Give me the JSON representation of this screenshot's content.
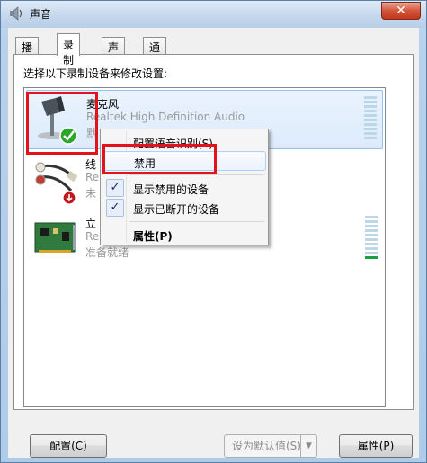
{
  "window": {
    "title": "声音",
    "close_label": "✕"
  },
  "tabs": [
    {
      "label": "播放"
    },
    {
      "label": "录制",
      "active": true
    },
    {
      "label": "声音"
    },
    {
      "label": "通信"
    }
  ],
  "instruction": "选择以下录制设备来修改设置:",
  "devices": [
    {
      "name": "麦克风",
      "description": "Realtek High Definition Audio",
      "status": "默",
      "icon": "microphone-icon",
      "badge": "default-check-icon"
    },
    {
      "name": "线",
      "description": "Re",
      "status": "未",
      "icon": "line-in-jack-icon",
      "badge": "down-arrow-badge-icon"
    },
    {
      "name": "立",
      "description": "Re",
      "status": "准备就绪",
      "icon": "sound-card-icon"
    }
  ],
  "context_menu": {
    "items": [
      {
        "label": "配置语音识别(S)"
      },
      {
        "label": "禁用"
      },
      {
        "label": "显示禁用的设备",
        "checked": true
      },
      {
        "label": "显示已断开的设备",
        "checked": true
      },
      {
        "label": "属性(P)"
      }
    ],
    "check_glyph": "✓"
  },
  "buttons": {
    "configure": "配置(C)",
    "set_default": "设为默认值(S)",
    "set_default_arrow": "▼",
    "properties": "属性(P)"
  },
  "colors": {
    "highlight_box": "#e1141b",
    "selection_bg": "#dcebfc",
    "level_active": "#14a33c"
  }
}
